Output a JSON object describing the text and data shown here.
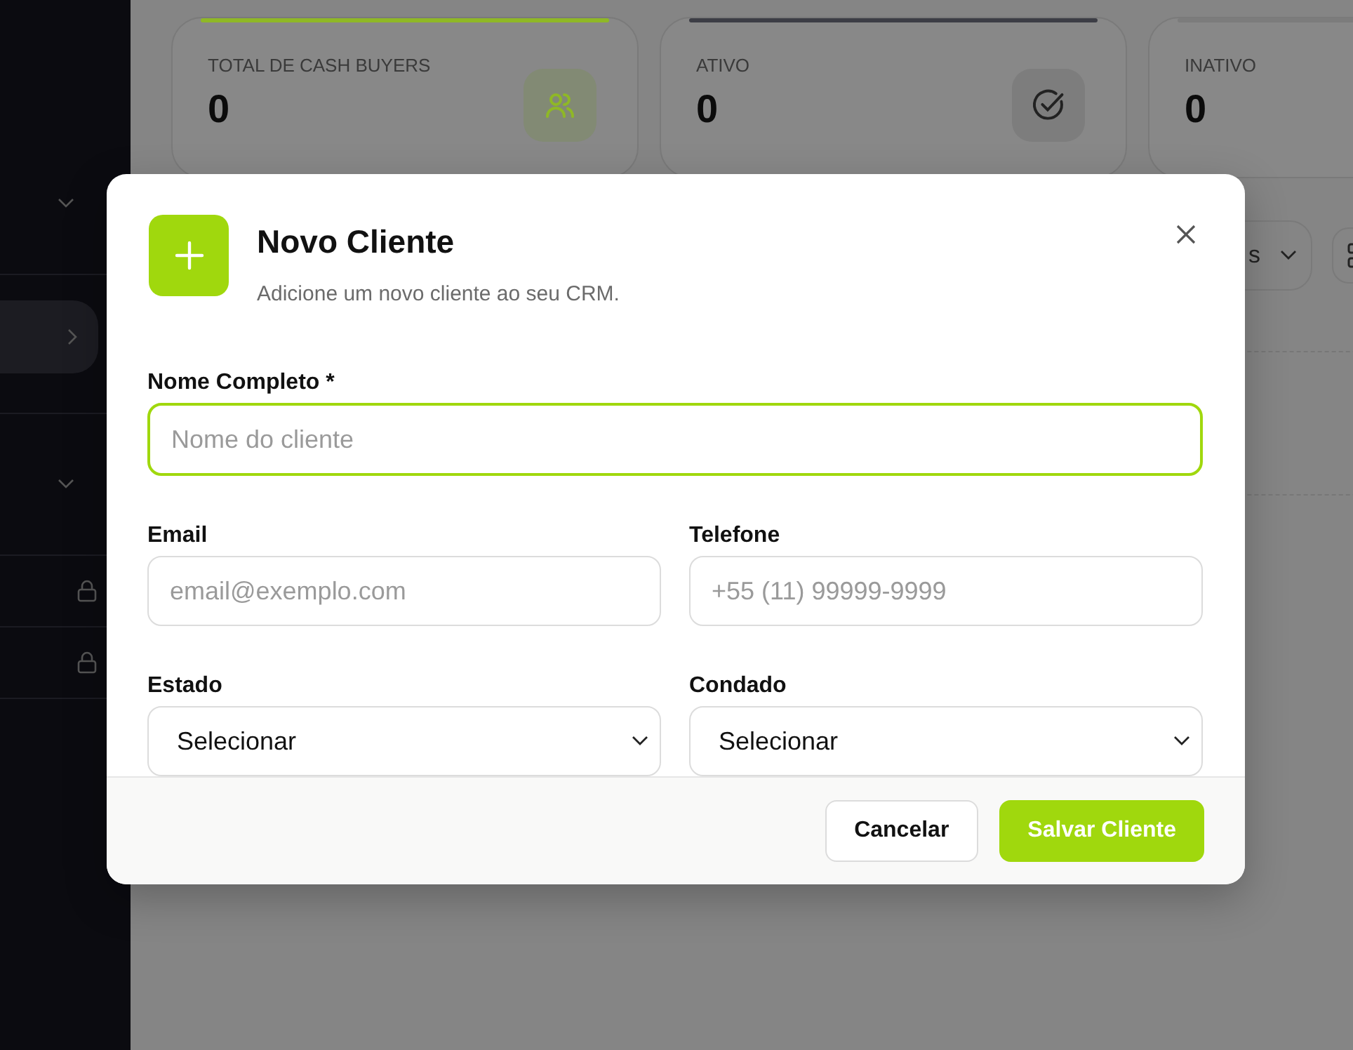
{
  "sidebar": {
    "items": [
      {
        "kind": "group",
        "selected": false
      },
      {
        "kind": "link",
        "selected": true
      },
      {
        "kind": "group",
        "selected": false
      },
      {
        "kind": "locked",
        "selected": false
      },
      {
        "kind": "locked",
        "selected": false
      }
    ]
  },
  "stats": [
    {
      "label": "TOTAL DE CASH BUYERS",
      "value": "0",
      "kind": "users",
      "color": "#8fb826"
    },
    {
      "label": "ATIVO",
      "value": "0",
      "kind": "check",
      "color": "#3c3d45"
    },
    {
      "label": "INATIVO",
      "value": "0",
      "kind": "plain",
      "color": "#7c7c7c"
    }
  ],
  "toolbar": {
    "filter_value": "s"
  },
  "modal": {
    "title": "Novo Cliente",
    "subtitle": "Adicione um novo cliente ao seu CRM.",
    "fields": [
      {
        "kind": "input",
        "label": "Nome Completo *",
        "placeholder": "Nome do cliente",
        "focused": true
      },
      {
        "kind": "input",
        "label": "Email",
        "placeholder": "email@exemplo.com",
        "focused": false
      },
      {
        "kind": "input",
        "label": "Telefone",
        "placeholder": "+55 (11) 99999-9999",
        "focused": false
      },
      {
        "kind": "select",
        "label": "Estado",
        "value": "Selecionar",
        "focused": false
      },
      {
        "kind": "select",
        "label": "Condado",
        "value": "Selecionar",
        "focused": false
      }
    ],
    "buttons": [
      {
        "kind": "secondary",
        "label": "Cancelar"
      },
      {
        "kind": "primary",
        "label": "Salvar Cliente"
      }
    ]
  }
}
